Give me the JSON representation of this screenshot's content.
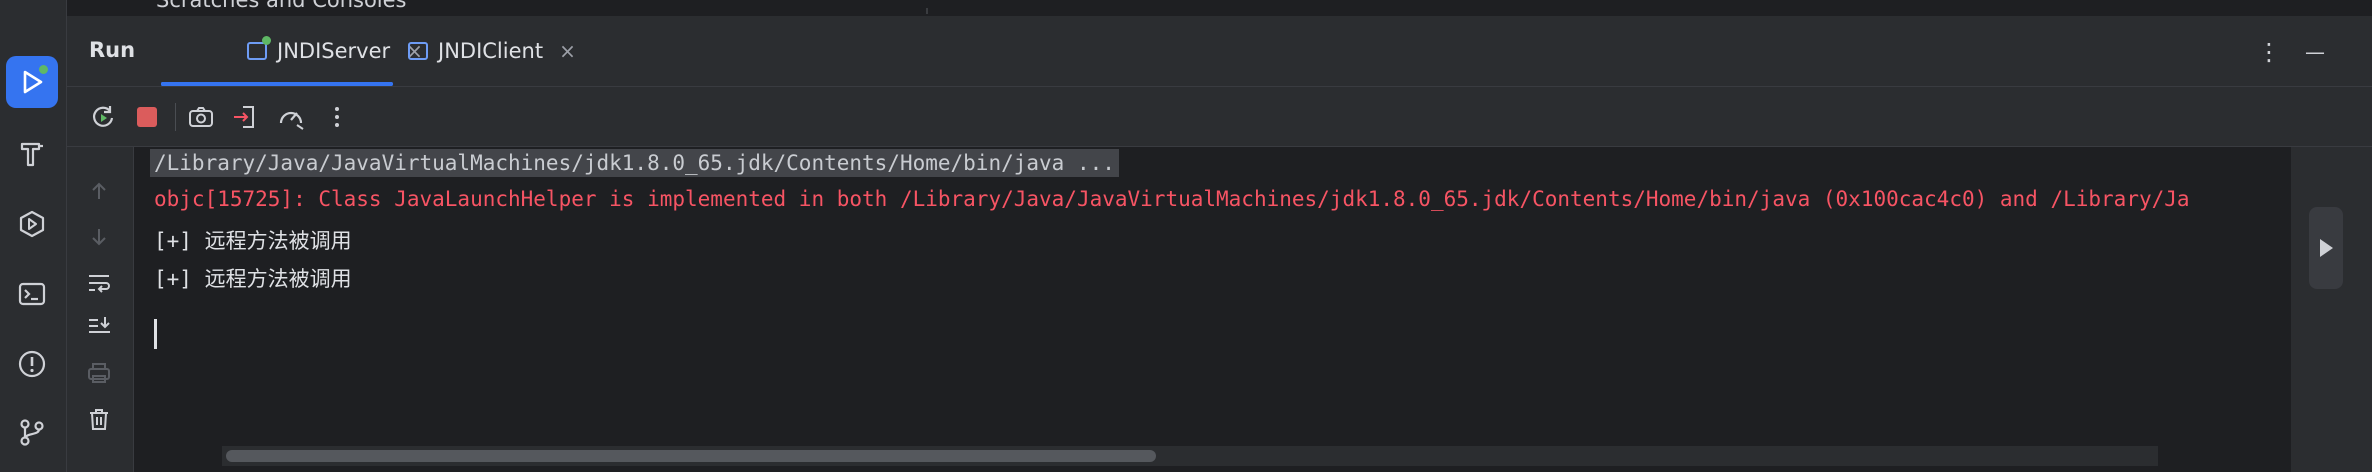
{
  "top_strip": {
    "ghost_text": "Scratches and Consoles"
  },
  "left_toolbar": {
    "items": [
      {
        "icon": "run-icon",
        "active": true
      },
      {
        "icon": "build-icon"
      },
      {
        "icon": "services-icon"
      },
      {
        "icon": "terminal-icon"
      },
      {
        "icon": "problems-icon"
      },
      {
        "icon": "git-icon"
      }
    ]
  },
  "header": {
    "title": "Run",
    "tabs": [
      {
        "label": "JNDIServer",
        "close": "×",
        "active": true
      },
      {
        "label": "JNDIClient",
        "close": "×",
        "active": false
      }
    ],
    "more_glyph": "⋮",
    "minimize_glyph": "—"
  },
  "toolbar": {
    "icons": [
      "rerun-icon",
      "stop-icon",
      "screenshot-icon",
      "login-icon",
      "speedometer-icon",
      "more-icon"
    ],
    "stop_color": "#db5c5c"
  },
  "gutter": {
    "icons": [
      "arrow-up-icon",
      "arrow-down-icon",
      "soft-wrap-icon",
      "scroll-to-end-icon",
      "print-icon",
      "trash-icon"
    ]
  },
  "console": {
    "command_line": "/Library/Java/JavaVirtualMachines/jdk1.8.0_65.jdk/Contents/Home/bin/java ...",
    "error_line": "objc[15725]: Class JavaLaunchHelper is implemented in both /Library/Java/JavaVirtualMachines/jdk1.8.0_65.jdk/Contents/Home/bin/java (0x100cac4c0) and /Library/Ja",
    "output_lines": [
      "[+] 远程方法被调用",
      "[+] 远程方法被调用"
    ]
  },
  "colors": {
    "accent": "#3574f0",
    "error": "#f75464",
    "running_dot": "#5fb865"
  }
}
